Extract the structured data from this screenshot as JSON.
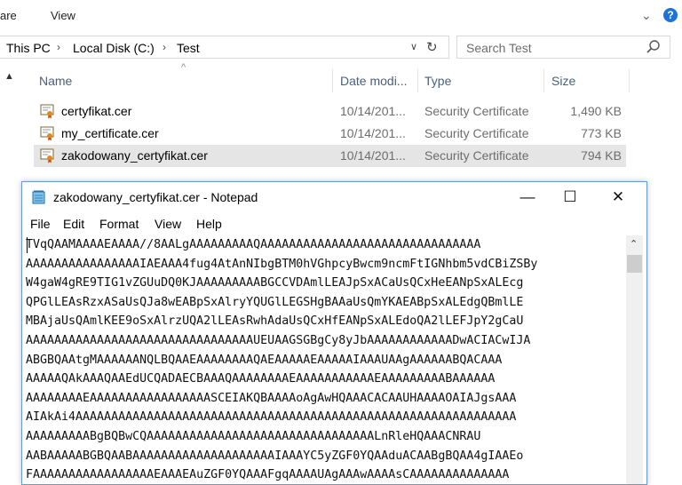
{
  "ribbon": {
    "tabs": [
      "are",
      "View"
    ],
    "help_label": "?"
  },
  "address": {
    "crumbs": [
      "This PC",
      "Local Disk (C:)",
      "Test"
    ],
    "search_placeholder": "Search Test"
  },
  "columns": {
    "name": "Name",
    "date": "Date modi...",
    "type": "Type",
    "size": "Size"
  },
  "files": [
    {
      "name": "certyfikat.cer",
      "date": "10/14/201...",
      "type": "Security Certificate",
      "size": "1,490 KB",
      "selected": false
    },
    {
      "name": "my_certificate.cer",
      "date": "10/14/201...",
      "type": "Security Certificate",
      "size": "773 KB",
      "selected": false
    },
    {
      "name": "zakodowany_certyfikat.cer",
      "date": "10/14/201...",
      "type": "Security Certificate",
      "size": "794 KB",
      "selected": true
    }
  ],
  "notepad": {
    "title": "zakodowany_certyfikat.cer - Notepad",
    "menu": [
      "File",
      "Edit",
      "Format",
      "View",
      "Help"
    ],
    "minimize": "—",
    "maximize": "☐",
    "close": "✕",
    "lines": [
      "TVqQAAMAAAAEAAAA//8AALgAAAAAAAAAQAAAAAAAAAAAAAAAAAAAAAAAAAAAAAAA",
      "AAAAAAAAAAAAAAAAIAEAAA4fug4AtAnNIbgBTM0hVGhpcyBwcm9ncmFtIGNhbm5vdCBiZSBy",
      "W4gaW4gRE9TIG1vZGUuDQ0KJAAAAAAAAABGCCVDAmlLEAJpSxACaUsQCxHeEANpSxALEcg",
      "QPGlLEAsRzxASaUsQJa8wEABpSxAlryYQUGlLEGSHgBAAaUsQmYKAEABpSxALEdgQBmlLE",
      "MBAjaUsQAmlKEE9oSxAlrzUQA2lLEAsRwhAdaUsQCxHfEANpSxALEdoQA2lLEFJpY2gCaU",
      "AAAAAAAAAAAAAAAAAAAAAAAAAAAAAAAAUEUAAGSGBgCy8yJbAAAAAAAAAAAADwACIACwIJA",
      "ABGBQAAtgMAAAAAANQLBQAAEAAAAAAAAQAEAAAAAEAAAAAIAAAUAAgAAAAAABQACAAA",
      "AAAAAQAkAAAQAAEdUCQADAECBAAAQAAAAAAAAEAAAAAAAAAAAEAAAAAAAAABAAAAAA",
      "AAAAAAAAEAAAAAAAAAAAAAAAAASCEIAKQBAAAAoAgAwHQAAACACAAUHAAAAOAIAJgsAAA",
      "AIAkAi4AAAAAAAAAAAAAAAAAAAAAAAAAAAAAAAAAAAAAAAAAAAAAAAAAAAAAAAAAAAAAA",
      "AAAAAAAAABgBQBwCQAAAAAAAAAAAAAAAAAAAAAAAAAAAAAAAALnRleHQAAACNRAU",
      "AABAAAAABGBQAABAAAAAAAAAAAAAAAAAAAAIAAAYC5yZGF0YQAAduACAABgBQAA4gIAAEo",
      "FAAAAAAAAAAAAAAAAAEAAAEAuZGF0YQAAAFgqAAAAUAgAAAwAAAAsCAAAAAAAAAAAAAA"
    ]
  }
}
